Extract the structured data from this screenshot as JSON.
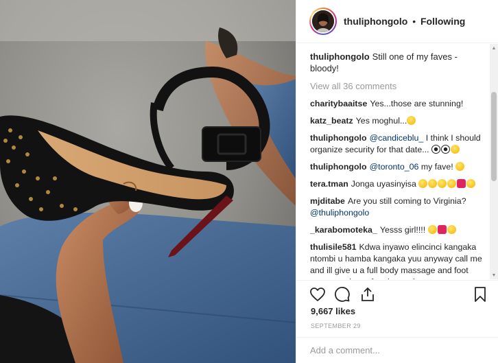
{
  "post": {
    "username": "thuliphongolo",
    "separator": "•",
    "follow_status": "Following",
    "caption": {
      "user": "thuliphongolo",
      "text": "Still one of my faves - bloody!"
    },
    "view_all": "View all 36 comments",
    "comments": [
      {
        "user": "charitybaaitse",
        "text": "Yes...those are stunning!",
        "emoji": []
      },
      {
        "user": "katz_beatz",
        "text": "Yes moghul...",
        "emoji": [
          "y"
        ]
      },
      {
        "user": "thuliphongolo",
        "mention": "@candiceblu_",
        "text": " I think I should organize security for that date... ",
        "emoji": [
          "k",
          "y"
        ]
      },
      {
        "user": "thuliphongolo",
        "mention": "@toronto_06",
        "text": " my fave! ",
        "emoji": [
          "y"
        ]
      },
      {
        "user": "tera.tman",
        "text": "Jonga uyasinyisa ",
        "emoji": [
          "y",
          "y",
          "y",
          "y",
          "r",
          "y"
        ]
      },
      {
        "user": "mjditabe",
        "text": "Are you still coming to Virginia? ",
        "mention_after": "@thuliphongolo",
        "emoji": []
      },
      {
        "user": "_karabomoteka_",
        "text": "Yesss girl!!!! ",
        "emoji": [
          "y",
          "r",
          "y"
        ]
      },
      {
        "user": "thulisile581",
        "text": "Kdwa inyawo elincinci kangaka ntombi u hamba kangaka yuu anyway call me and ill give u a full body massage and foot massage thereafter, let me know...",
        "emoji": []
      }
    ],
    "likes": "9,667 likes",
    "date": "SEPTEMBER 29",
    "add_comment_placeholder": "Add a comment..."
  },
  "icons": {
    "like": "heart-icon",
    "comment": "comment-bubble-icon",
    "share": "share-icon",
    "save": "bookmark-icon"
  },
  "colors": {
    "text": "#262626",
    "muted": "#999999",
    "mention": "#003569",
    "border": "#efefef"
  }
}
